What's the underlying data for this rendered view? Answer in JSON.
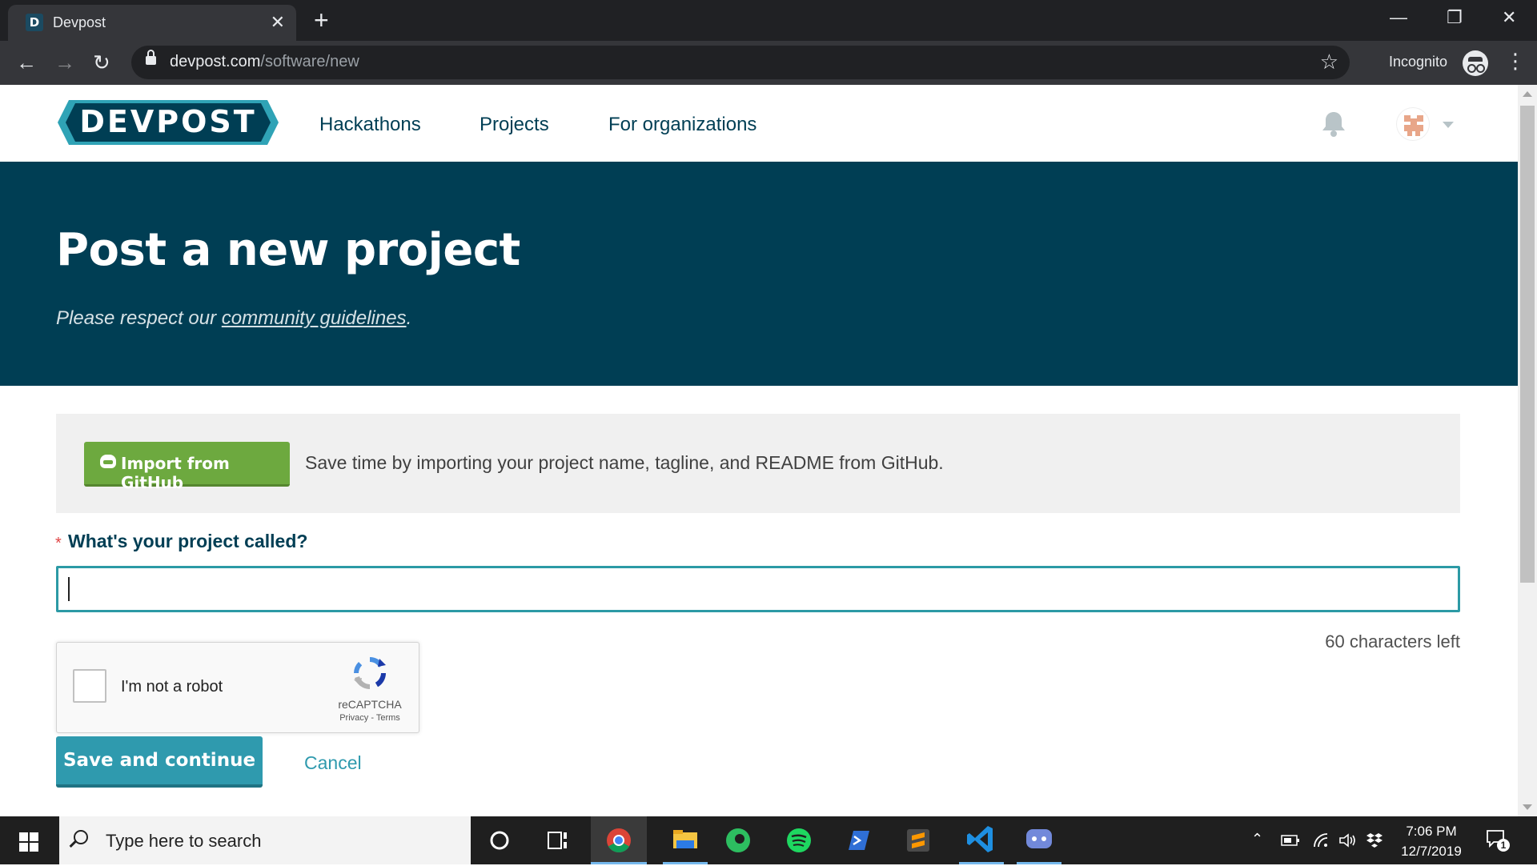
{
  "browser": {
    "tab_title": "Devpost",
    "tab_favicon": "D",
    "url_host": "devpost.com",
    "url_path": "/software/new",
    "profile_label": "Incognito"
  },
  "site": {
    "logo_text": "DEVPOST",
    "nav": [
      "Hackathons",
      "Projects",
      "For organizations"
    ],
    "brand_color": "#003e54",
    "accent_color": "#2f9aae"
  },
  "hero": {
    "title": "Post a new project",
    "sub_prefix": "Please respect our ",
    "sub_link": "community guidelines",
    "sub_suffix": "."
  },
  "import": {
    "button_label": "Import from GitHub",
    "description": "Save time by importing your project name, tagline, and README from GitHub."
  },
  "form": {
    "required_mark": "*",
    "name_label": "What's your project called?",
    "name_value": "",
    "chars_left": "60 characters left",
    "save_label": "Save and continue",
    "cancel_label": "Cancel"
  },
  "recaptcha": {
    "label": "I'm not a robot",
    "brand": "reCAPTCHA",
    "privacy": "Privacy",
    "separator": " - ",
    "terms": "Terms"
  },
  "taskbar": {
    "search_placeholder": "Type here to search",
    "time": "7:06 PM",
    "date": "12/7/2019",
    "notification_count": "1",
    "apps": [
      "cortana-icon",
      "task-view-icon",
      "chrome-icon",
      "file-explorer-icon",
      "evernote-icon",
      "spotify-icon",
      "powershell-icon",
      "sublime-text-icon",
      "vscode-icon",
      "discord-icon"
    ]
  }
}
